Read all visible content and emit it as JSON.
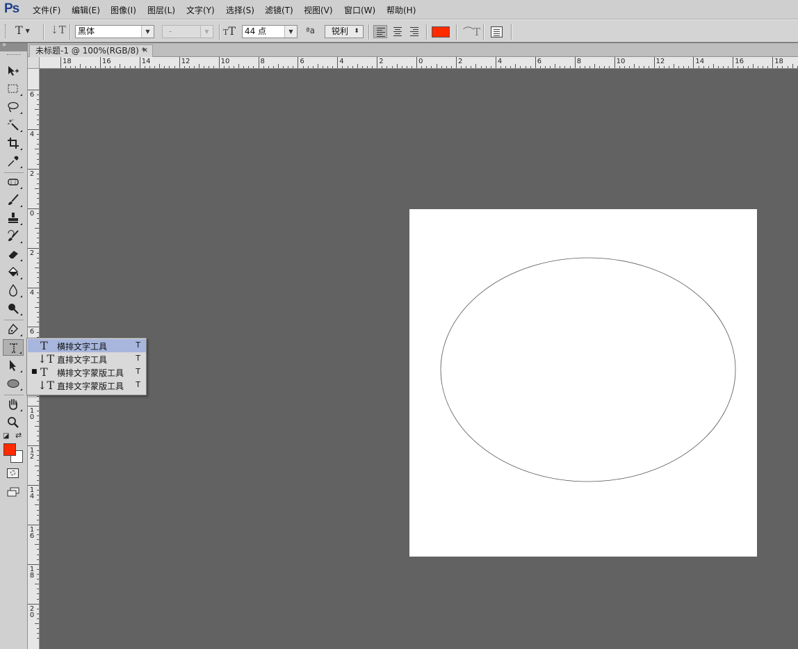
{
  "app": {
    "logo": "Ps"
  },
  "menu": [
    "文件(F)",
    "编辑(E)",
    "图像(I)",
    "图层(L)",
    "文字(Y)",
    "选择(S)",
    "滤镜(T)",
    "视图(V)",
    "窗口(W)",
    "帮助(H)"
  ],
  "options": {
    "font_family": "黑体",
    "font_style": "-",
    "font_size": "44 点",
    "antialias_icon": "ªa",
    "antialias": "锐利",
    "text_color": "#ff2a00"
  },
  "document": {
    "tab_title": "未标题-1 @ 100%(RGB/8) *",
    "close_glyph": "×"
  },
  "rulers": {
    "horizontal_labels": [
      "18",
      "16",
      "14",
      "12",
      "10",
      "8",
      "6",
      "4",
      "2",
      "0",
      "2",
      "4",
      "6",
      "8",
      "10",
      "12",
      "14",
      "16",
      "18"
    ],
    "vertical_labels": [
      "6",
      "4",
      "2",
      "0",
      "2",
      "4",
      "6",
      "8",
      "10",
      "12",
      "14",
      "16",
      "18",
      "20"
    ]
  },
  "toolbox": {
    "tools": [
      "move-tool",
      "marquee-tool",
      "lasso-tool",
      "magic-wand-tool",
      "crop-tool",
      "eyedropper-tool",
      "healing-brush-tool",
      "brush-tool",
      "clone-stamp-tool",
      "history-brush-tool",
      "eraser-tool",
      "paint-bucket-tool",
      "blur-tool",
      "dodge-tool",
      "pen-tool",
      "type-tool",
      "path-selection-tool",
      "ellipse-tool",
      "hand-tool",
      "zoom-tool"
    ],
    "selected": "type-tool",
    "foreground_color": "#ff2a00",
    "background_color": "#ffffff"
  },
  "flyout": {
    "items": [
      {
        "label": "横排文字工具",
        "shortcut": "T",
        "icon": "T",
        "highlighted": true,
        "bullet": ""
      },
      {
        "label": "直排文字工具",
        "shortcut": "T",
        "icon": "↓T",
        "highlighted": false,
        "bullet": ""
      },
      {
        "label": "横排文字蒙版工具",
        "shortcut": "T",
        "icon": "T",
        "highlighted": false,
        "bullet": "■"
      },
      {
        "label": "直排文字蒙版工具",
        "shortcut": "T",
        "icon": "↓T",
        "highlighted": false,
        "bullet": ""
      }
    ]
  },
  "colors": {
    "workspace": "#626262",
    "canvas": "#ffffff",
    "flyout_highlight": "#a8b6dd"
  }
}
